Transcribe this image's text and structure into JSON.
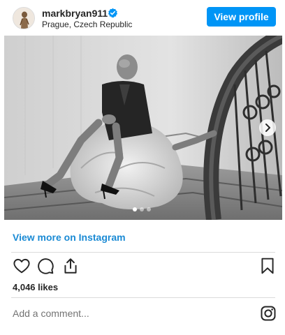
{
  "header": {
    "username": "markbryan911",
    "location": "Prague, Czech Republic",
    "view_profile_label": "View profile",
    "verified_icon": "verified-badge-icon"
  },
  "media": {
    "carousel_total": 3,
    "carousel_active": 1,
    "next_icon": "chevron-right-icon"
  },
  "view_more_label": "View more on Instagram",
  "actions": {
    "icons": [
      "heart-icon",
      "comment-icon",
      "share-icon",
      "bookmark-icon"
    ]
  },
  "likes_text": "4,046 likes",
  "comment": {
    "placeholder": "Add a comment..."
  },
  "footer_icon": "instagram-logo-icon",
  "colors": {
    "accent": "#0095f6",
    "link": "#1a8ad4",
    "text": "#262626",
    "muted": "#737373",
    "divider": "#dbdbdb"
  }
}
